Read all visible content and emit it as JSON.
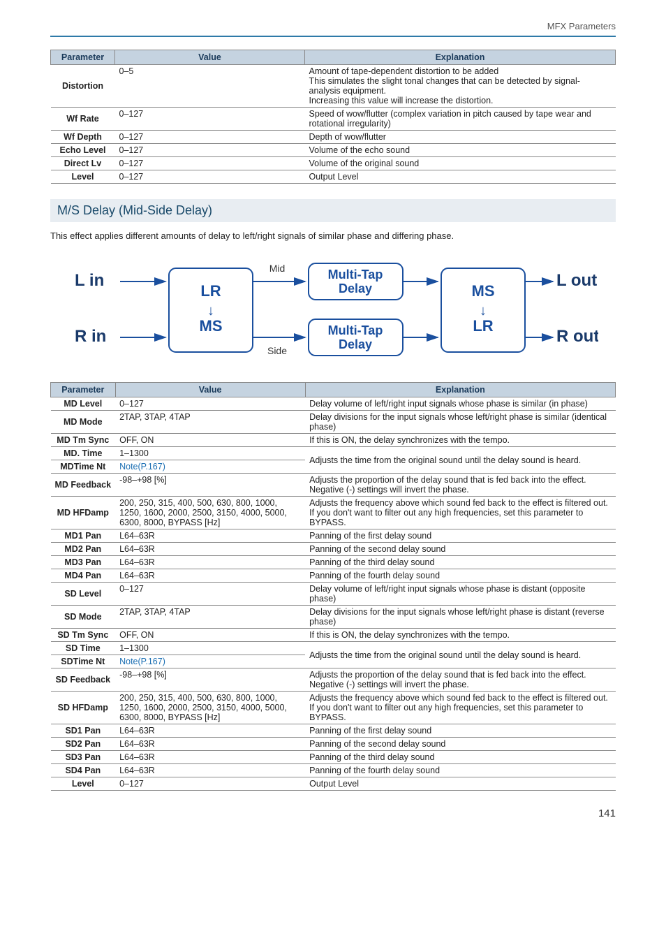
{
  "header": {
    "breadcrumb": "MFX Parameters"
  },
  "table1": {
    "headers": {
      "param": "Parameter",
      "value": "Value",
      "expl": "Explanation"
    },
    "rows": [
      {
        "param": "Distortion",
        "value": "0–5",
        "expl": "Amount of tape-dependent distortion to be added\nThis simulates the slight tonal changes that can be detected by signal-analysis equipment.\nIncreasing this value will increase the distortion."
      },
      {
        "param": "Wf Rate",
        "value": "0–127",
        "expl": "Speed of wow/flutter (complex variation in pitch caused by tape wear and rotational irregularity)"
      },
      {
        "param": "Wf Depth",
        "value": "0–127",
        "expl": "Depth of wow/flutter"
      },
      {
        "param": "Echo Level",
        "value": "0–127",
        "expl": "Volume of the echo sound"
      },
      {
        "param": "Direct Lv",
        "value": "0–127",
        "expl": "Volume of the original sound"
      },
      {
        "param": "Level",
        "value": "0–127",
        "expl": "Output Level"
      }
    ]
  },
  "section": {
    "title": "M/S Delay (Mid-Side Delay)",
    "desc": "This effect applies different amounts of delay to left/right signals of similar phase and differing phase."
  },
  "diagram": {
    "l_in": "L in",
    "r_in": "R in",
    "l_out": "L out",
    "r_out": "R out",
    "lr": "LR",
    "ms": "MS",
    "mid": "Mid",
    "side": "Side",
    "multitap": "Multi-Tap",
    "delay": "Delay"
  },
  "table2": {
    "headers": {
      "param": "Parameter",
      "value": "Value",
      "expl": "Explanation"
    },
    "note_ref": "Note(P.167)",
    "rows": [
      {
        "param": "MD Level",
        "value": "0–127",
        "expl": "Delay volume of left/right input signals whose phase is similar (in phase)"
      },
      {
        "param": "MD Mode",
        "value": "2TAP, 3TAP, 4TAP",
        "expl": "Delay divisions for the input signals whose left/right phase is similar (identical phase)"
      },
      {
        "param": "MD Tm Sync",
        "value": "OFF, ON",
        "expl": "If this is ON, the delay synchronizes with the tempo."
      },
      {
        "param": "MD. Time",
        "value": "1–1300",
        "expl_shared": true
      },
      {
        "param": "MDTime Nt",
        "value_link": true,
        "expl": "Adjusts the time from the original sound until the delay sound is heard."
      },
      {
        "param": "MD Feedback",
        "value": "-98–+98 [%]",
        "expl": "Adjusts the proportion of the delay sound that is fed back into the effect.\nNegative (-) settings will invert the phase."
      },
      {
        "param": "MD HFDamp",
        "value": "200, 250, 315, 400, 500, 630, 800, 1000, 1250, 1600, 2000, 2500, 3150, 4000, 5000, 6300, 8000, BYPASS [Hz]",
        "expl": "Adjusts the frequency above which sound fed back to the effect is filtered out. If you don't want to filter out any high frequencies, set this parameter to BYPASS."
      },
      {
        "param": "MD1 Pan",
        "value": "L64–63R",
        "expl": "Panning of the first delay sound"
      },
      {
        "param": "MD2 Pan",
        "value": "L64–63R",
        "expl": "Panning of the second delay sound"
      },
      {
        "param": "MD3 Pan",
        "value": "L64–63R",
        "expl": "Panning of the third delay sound"
      },
      {
        "param": "MD4 Pan",
        "value": "L64–63R",
        "expl": "Panning of the fourth delay sound"
      },
      {
        "param": "SD Level",
        "value": "0–127",
        "expl": "Delay volume of left/right input signals whose phase is distant (opposite phase)"
      },
      {
        "param": "SD Mode",
        "value": "2TAP, 3TAP, 4TAP",
        "expl": "Delay divisions for the input signals whose left/right phase is distant (reverse phase)"
      },
      {
        "param": "SD Tm Sync",
        "value": "OFF, ON",
        "expl": "If this is ON, the delay synchronizes with the tempo."
      },
      {
        "param": "SD Time",
        "value": "1–1300",
        "expl_shared": true
      },
      {
        "param": "SDTime Nt",
        "value_link": true,
        "expl": "Adjusts the time from the original sound until the delay sound is heard."
      },
      {
        "param": "SD Feedback",
        "value": "-98–+98 [%]",
        "expl": "Adjusts the proportion of the delay sound that is fed back into the effect.\nNegative (-) settings will invert the phase."
      },
      {
        "param": "SD HFDamp",
        "value": "200, 250, 315, 400, 500, 630, 800, 1000, 1250, 1600, 2000, 2500, 3150, 4000, 5000, 6300, 8000, BYPASS [Hz]",
        "expl": "Adjusts the frequency above which sound fed back to the effect is filtered out. If you don't want to filter out any high frequencies, set this parameter to BYPASS."
      },
      {
        "param": "SD1 Pan",
        "value": "L64–63R",
        "expl": "Panning of the first delay sound"
      },
      {
        "param": "SD2 Pan",
        "value": "L64–63R",
        "expl": "Panning of the second delay sound"
      },
      {
        "param": "SD3 Pan",
        "value": "L64–63R",
        "expl": "Panning of the third delay sound"
      },
      {
        "param": "SD4 Pan",
        "value": "L64–63R",
        "expl": "Panning of the fourth delay sound"
      },
      {
        "param": "Level",
        "value": "0–127",
        "expl": "Output Level"
      }
    ]
  },
  "page_number": "141"
}
